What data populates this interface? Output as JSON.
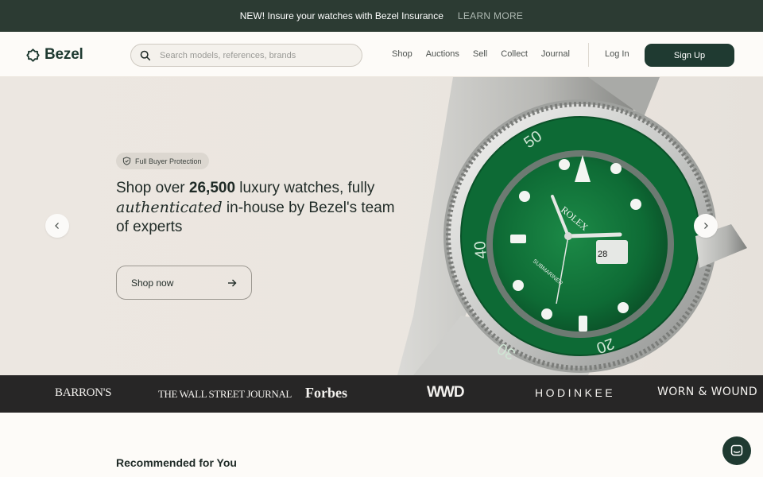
{
  "announcement": {
    "text": "NEW! Insure your watches with Bezel Insurance",
    "link": "LEARN MORE"
  },
  "header": {
    "logo_text": "Bezel",
    "search_placeholder": "Search models, references, brands",
    "nav": [
      "Shop",
      "Auctions",
      "Sell",
      "Collect",
      "Journal"
    ],
    "login": "Log In",
    "signup": "Sign Up"
  },
  "hero": {
    "badge": "Full Buyer Protection",
    "headline": {
      "part1": "Shop over ",
      "count": "26,500",
      "part2": " luxury watches, fully",
      "emphasis": "authenticated",
      "part3": " in-house by Bezel's team of experts"
    },
    "cta": "Shop now"
  },
  "press": {
    "barrons": "BARRON'S",
    "wsj": "THE WALL STREET JOURNAL",
    "forbes": "Forbes",
    "wwd": "WWD",
    "hodinkee": "HODINKEE",
    "worn": "WORN & WOUND"
  },
  "recommended": {
    "title": "Recommended for You"
  },
  "icons": {
    "logo": "bezel-logo-icon",
    "search": "search-icon",
    "shield": "shield-check-icon",
    "arrow": "arrow-right-icon",
    "prev": "chevron-left-icon",
    "next": "chevron-right-icon",
    "chat": "chat-icon"
  },
  "colors": {
    "brand": "#1f3a31",
    "announcement_bg": "#2c3b33",
    "press_bg": "#272626",
    "dial_green": "#0f7a3d"
  }
}
